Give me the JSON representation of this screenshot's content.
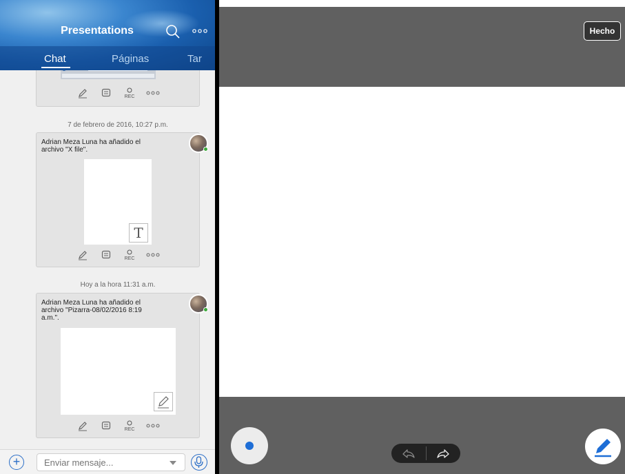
{
  "header": {
    "title": "Presentations",
    "tabs": [
      {
        "label": "Chat",
        "active": true
      },
      {
        "label": "Páginas",
        "active": false
      },
      {
        "label": "Tar",
        "active": false
      }
    ]
  },
  "feed": {
    "items": [
      {
        "timestamp": "7 de febrero de 2016, 10:27 p.m.",
        "message": "Adrian Meza Luna ha añadido el archivo \"X file\".",
        "preview_icon": "T"
      },
      {
        "timestamp": "Hoy a la hora 11:31 a.m.",
        "message": "Adrian Meza Luna ha añadido el archivo \"Pizarra-08/02/2016 8:19 a.m.\".",
        "preview_icon": "pencil-icon"
      }
    ],
    "rec_label": "REC"
  },
  "compose": {
    "placeholder": "Enviar mensaje..."
  },
  "canvas": {
    "done_label": "Hecho",
    "brush_color": "#1e6ed6"
  },
  "colors": {
    "accent": "#2b6ec7",
    "online": "#3aa83a"
  }
}
